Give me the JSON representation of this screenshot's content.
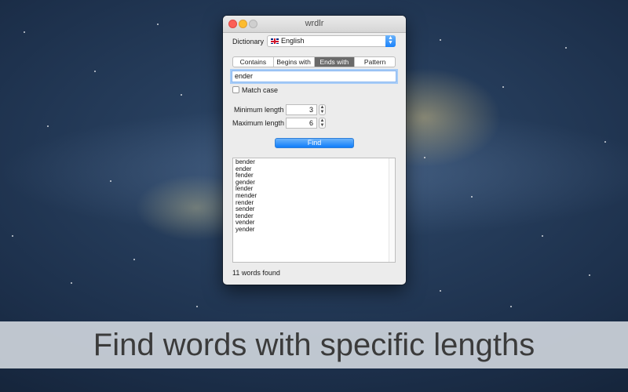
{
  "window": {
    "title": "wrdlr"
  },
  "dictionary": {
    "label": "Dictionary",
    "selected": "English"
  },
  "tabs": [
    {
      "label": "Contains",
      "active": false
    },
    {
      "label": "Begins with",
      "active": false
    },
    {
      "label": "Ends with",
      "active": true
    },
    {
      "label": "Pattern",
      "active": false
    }
  ],
  "search": {
    "value": "ender"
  },
  "match_case": {
    "label": "Match case",
    "checked": false
  },
  "min_length": {
    "label": "Minimum length",
    "value": "3"
  },
  "max_length": {
    "label": "Maximum length",
    "value": "6"
  },
  "find_button": {
    "label": "Find"
  },
  "results": [
    "bender",
    "ender",
    "fender",
    "gender",
    "lender",
    "mender",
    "render",
    "sender",
    "tender",
    "vender",
    "yender"
  ],
  "status": "11 words found",
  "caption": "Find words with specific lengths"
}
